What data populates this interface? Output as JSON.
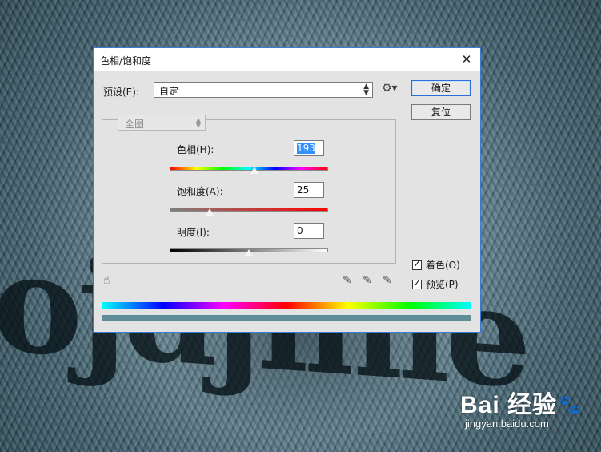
{
  "background": {
    "text": "ojdjinle",
    "watermark": {
      "logo": "Bai 经验",
      "paw": "🐾",
      "url": "jingyan.baidu.com"
    }
  },
  "dialog": {
    "title": "色相/饱和度",
    "close_icon": "close-icon",
    "preset": {
      "label": "预设(E):",
      "value": "自定"
    },
    "gear_icon": "gear-icon",
    "buttons": {
      "ok": "确定",
      "reset": "复位"
    },
    "channel": "全图",
    "hue": {
      "label": "色相(H):",
      "value": "193",
      "position": 0.535
    },
    "saturation": {
      "label": "饱和度(A):",
      "value": "25",
      "position": 0.25
    },
    "lightness": {
      "label": "明度(I):",
      "value": "0",
      "position": 0.5
    },
    "colorize": {
      "label": "着色(O)",
      "checked": true
    },
    "preview": {
      "label": "预览(P)",
      "checked": true
    },
    "result_color": "#5f8e99",
    "accent_color": "#2a6fd6"
  }
}
